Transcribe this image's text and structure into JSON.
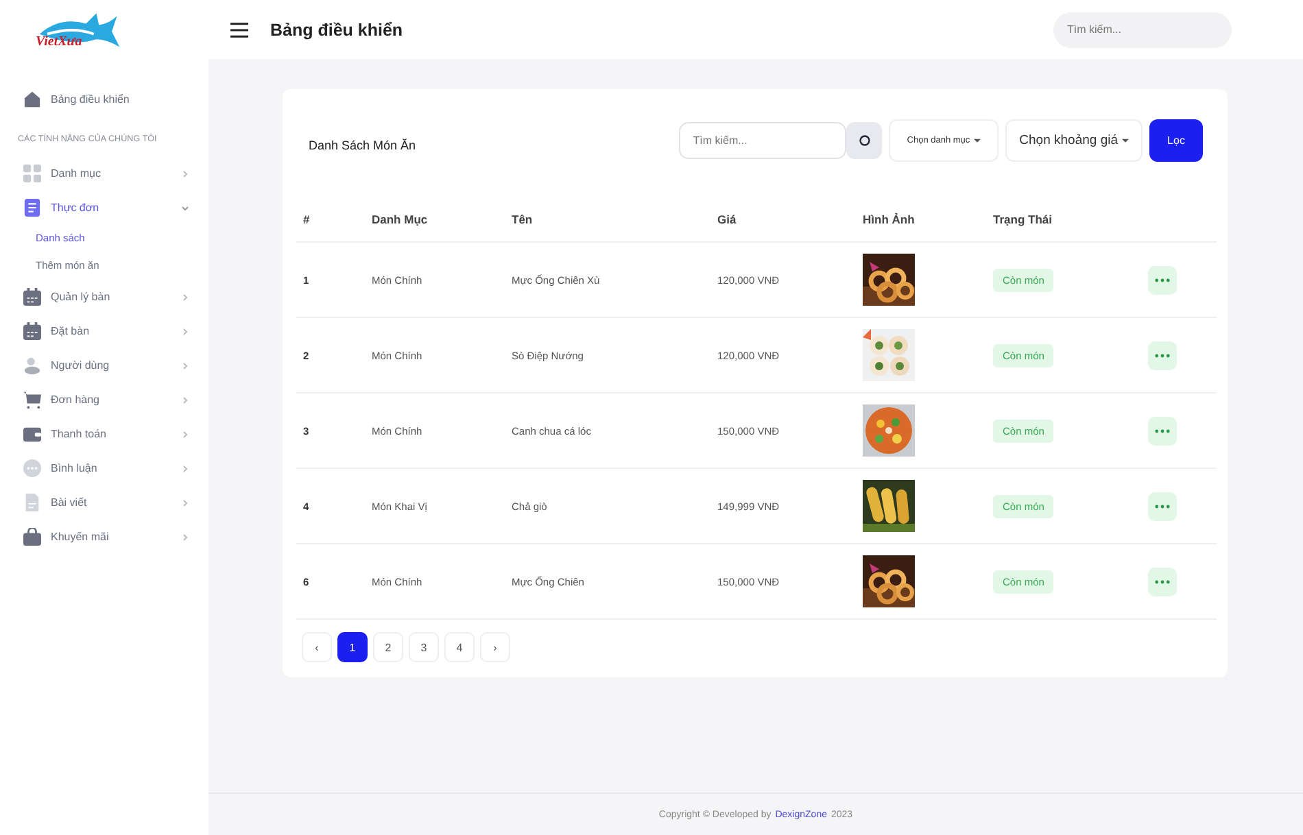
{
  "logo": {
    "text": "VietXưa"
  },
  "header": {
    "title": "Bảng điều khiển",
    "search": {
      "placeholder": "Tìm kiếm..."
    }
  },
  "sidebar": {
    "home": {
      "label": "Bảng điều khiển"
    },
    "section": "CÁC TÍNH NĂNG CỦA CHÚNG TÔI",
    "items": [
      {
        "label": "Danh mục",
        "kind": "grid",
        "expanded": false,
        "selected": false
      },
      {
        "label": "Thực đơn",
        "kind": "doc",
        "expanded": true,
        "selected": true,
        "children": [
          {
            "label": "Danh sách",
            "selected": true
          },
          {
            "label": "Thêm món ăn",
            "selected": false
          }
        ]
      },
      {
        "label": "Quản lý bàn",
        "kind": "calendar",
        "expanded": false,
        "selected": false
      },
      {
        "label": "Đặt bàn",
        "kind": "calendar",
        "expanded": false,
        "selected": false
      },
      {
        "label": "Người dùng",
        "kind": "users",
        "expanded": false,
        "selected": false
      },
      {
        "label": "Đơn hàng",
        "kind": "cart",
        "expanded": false,
        "selected": false
      },
      {
        "label": "Thanh toán",
        "kind": "wallet",
        "expanded": false,
        "selected": false
      },
      {
        "label": "Bình luận",
        "kind": "chat",
        "expanded": false,
        "selected": false
      },
      {
        "label": "Bài viết",
        "kind": "file",
        "expanded": false,
        "selected": false
      },
      {
        "label": "Khuyến mãi",
        "kind": "bag",
        "expanded": false,
        "selected": false
      }
    ]
  },
  "card": {
    "title": "Danh Sách Món Ăn",
    "search": {
      "placeholder": "Tìm kiếm..."
    },
    "category_select": "Chọn danh mục",
    "price_select": "Chọn khoảng giá",
    "filter_button": "Lọc"
  },
  "table": {
    "columns": [
      "#",
      "Danh Mục",
      "Tên",
      "Giá",
      "Hình Ảnh",
      "Trạng Thái"
    ],
    "rows": [
      {
        "id": "1",
        "category": "Món Chính",
        "name": "Mực Ống Chiên Xù",
        "price": "120,000 VNĐ",
        "status": "Còn món"
      },
      {
        "id": "2",
        "category": "Món Chính",
        "name": "Sò Điệp Nướng",
        "price": "120,000 VNĐ",
        "status": "Còn món"
      },
      {
        "id": "3",
        "category": "Món Chính",
        "name": "Canh chua cá lóc",
        "price": "150,000 VNĐ",
        "status": "Còn món"
      },
      {
        "id": "4",
        "category": "Món Khai Vị",
        "name": "Chả giò",
        "price": "149,999 VNĐ",
        "status": "Còn món"
      },
      {
        "id": "6",
        "category": "Món Chính",
        "name": "Mực Ống Chiên",
        "price": "150,000 VNĐ",
        "status": "Còn món"
      }
    ]
  },
  "pagination": {
    "prev": "‹",
    "next": "›",
    "pages": [
      {
        "label": "1",
        "selected": true
      },
      {
        "label": "2",
        "selected": false
      },
      {
        "label": "3",
        "selected": false
      },
      {
        "label": "4",
        "selected": false
      }
    ]
  },
  "footer": {
    "text": "Copyright © Developed by",
    "link": "DexignZone",
    "year": "2023"
  }
}
